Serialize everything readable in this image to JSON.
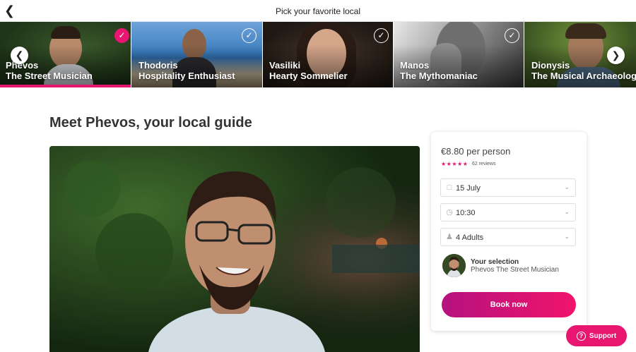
{
  "header": {
    "title": "Pick your favorite local",
    "back_icon": "chevron-left-icon"
  },
  "carousel": {
    "prev_icon": "chevron-left-icon",
    "next_icon": "chevron-right-icon",
    "locals": [
      {
        "first": "Phevos",
        "role": "The Street Musician",
        "selected": true
      },
      {
        "first": "Thodoris",
        "role": "Hospitality Enthusiast",
        "selected": false
      },
      {
        "first": "Vasiliki",
        "role": "Hearty Sommelier",
        "selected": false
      },
      {
        "first": "Manos",
        "role": "The Mythomaniac",
        "selected": false
      },
      {
        "first": "Dionysis",
        "role": "The Musical Archaeologist",
        "selected": false
      }
    ]
  },
  "main": {
    "heading": "Meet Phevos, your local guide"
  },
  "booking": {
    "price": "€8.80 per person",
    "rating": 5,
    "reviews": "62 reviews",
    "date": "15 July",
    "time": "10:30",
    "guests": "4 Adults",
    "selection_title": "Your selection",
    "selection_name": "Phevos The Street Musician",
    "book_label": "Book now"
  },
  "support": {
    "label": "Support"
  },
  "colors": {
    "accent": "#e8166f",
    "button_gradient_start": "#b5127f",
    "button_gradient_end": "#f0146c"
  }
}
